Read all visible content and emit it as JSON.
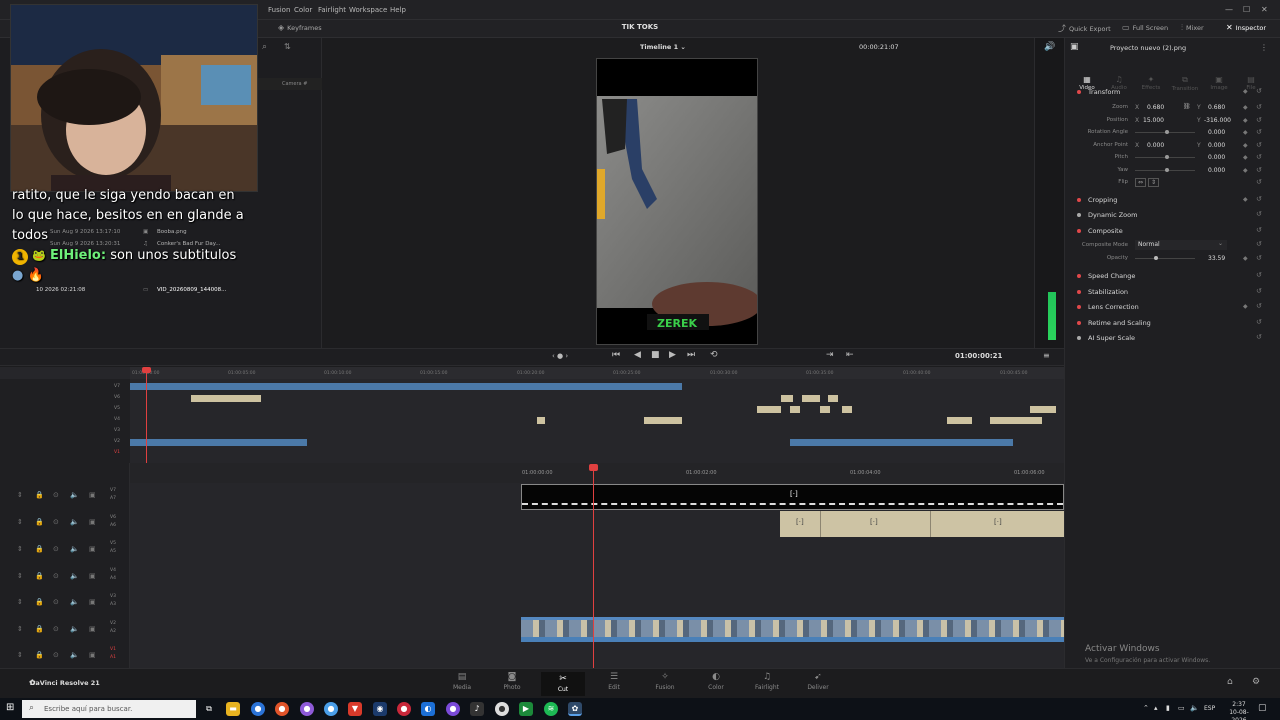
{
  "menubar": {
    "items": [
      "Fusion",
      "Color",
      "Fairlight",
      "Workspace",
      "Help"
    ]
  },
  "toolbar": {
    "keyframes": "Keyframes",
    "project_title": "TIK TOKS",
    "quick_export": "Quick Export",
    "full_screen": "Full Screen",
    "mixer": "Mixer",
    "inspector": "Inspector"
  },
  "viewer": {
    "timeline_name": "Timeline 1",
    "duration_tc": "00:00:21:07",
    "watermark": "ZEREK"
  },
  "media_pool": {
    "column": "Camera #",
    "rows": [
      {
        "date": "Sun Aug 9 2026 13:17:10",
        "name": "Booba.png"
      },
      {
        "date": "Sun Aug 9 2026 13:20:31",
        "name": "Conker's Bad Fur Day..."
      },
      {
        "date": "10 2026 02:21:08",
        "name": "VID_20260809_144008..."
      }
    ]
  },
  "chat": {
    "line1": "ratito, que le siga yendo bacan en",
    "line2": "lo que hace, besitos en en glande a",
    "line3": "todos",
    "user": "ElHielo:",
    "message": "son unos subtitulos",
    "badge": "1"
  },
  "transport": {
    "timecode": "01:00:00:21"
  },
  "upper_ruler": [
    "01:00:00:00",
    "01:00:05:00",
    "01:00:10:00",
    "01:00:15:00",
    "01:00:20:00",
    "01:00:25:00",
    "01:00:30:00",
    "01:00:35:00",
    "01:00:40:00",
    "01:00:45:00"
  ],
  "lower_ruler": [
    "01:00:00:00",
    "01:00:02:00",
    "01:00:04:00",
    "01:00:06:00"
  ],
  "upper_tracks": [
    "V7",
    "V6",
    "V5",
    "V4",
    "V3",
    "V2",
    "V1"
  ],
  "lower_tracks": [
    "V7",
    "A7",
    "V6",
    "A6",
    "V5",
    "A5",
    "V4",
    "A4",
    "V3",
    "A3",
    "V2",
    "A2",
    "V1",
    "A1"
  ],
  "inspector": {
    "file_name": "Proyecto nuevo (2).png",
    "tabs": [
      "Video",
      "Audio",
      "Effects",
      "Transition",
      "Image",
      "File"
    ],
    "transform": "Transform",
    "zoom_label": "Zoom",
    "zoom_x": "0.680",
    "zoom_y": "0.680",
    "position_label": "Position",
    "position_x": "15.000",
    "position_y": "-316.000",
    "rotation_label": "Rotation Angle",
    "rotation_val": "0.000",
    "anchor_label": "Anchor Point",
    "anchor_x": "0.000",
    "anchor_y": "0.000",
    "pitch_label": "Pitch",
    "pitch_val": "0.000",
    "yaw_label": "Yaw",
    "yaw_val": "0.000",
    "flip_label": "Flip",
    "cropping": "Cropping",
    "dynamic_zoom": "Dynamic Zoom",
    "composite": "Composite",
    "composite_mode_label": "Composite Mode",
    "composite_mode": "Normal",
    "opacity_label": "Opacity",
    "opacity_val": "33.59",
    "speed_change": "Speed Change",
    "stabilization": "Stabilization",
    "lens_correction": "Lens Correction",
    "retime": "Retime and Scaling",
    "ai_super_scale": "AI Super Scale",
    "x": "X",
    "y": "Y"
  },
  "pages": [
    {
      "label": "Media",
      "icon": "media-icon"
    },
    {
      "label": "Photo",
      "icon": "photo-icon"
    },
    {
      "label": "Cut",
      "icon": "cut-icon"
    },
    {
      "label": "Edit",
      "icon": "edit-icon"
    },
    {
      "label": "Fusion",
      "icon": "fusion-icon"
    },
    {
      "label": "Color",
      "icon": "color-icon"
    },
    {
      "label": "Fairlight",
      "icon": "fairlight-icon"
    },
    {
      "label": "Deliver",
      "icon": "deliver-icon"
    }
  ],
  "app_name": "DaVinci Resolve 21",
  "activate": {
    "title": "Activar Windows",
    "sub": "Ve a Configuración para activar Windows."
  },
  "taskbar": {
    "search_placeholder": "Escribe aquí para buscar.",
    "lang": "ESP",
    "time": "2:37",
    "date": "10-08-2026"
  },
  "colors": {
    "accent_red": "#e04040",
    "clip_blue": "#4b79a8",
    "clip_beige": "#cdc2a0",
    "meter_green": "#22c45a"
  }
}
